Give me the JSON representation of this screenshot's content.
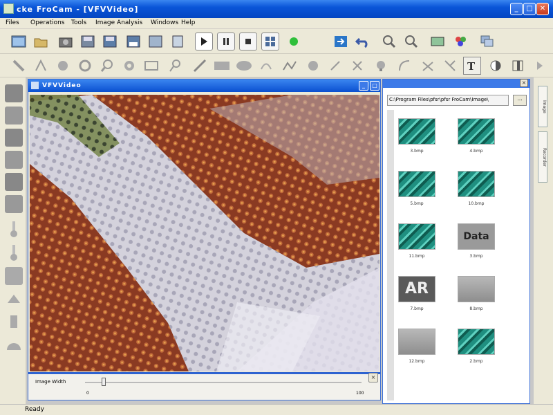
{
  "window": {
    "title": "cke FroCam - [VFVVideo]"
  },
  "menu": [
    "Files",
    "Operations",
    "Tools",
    "Image Analysis",
    "Windows",
    "Help"
  ],
  "toolbar1": [
    "window-icon",
    "folder-icon",
    "camera-icon",
    "save-icon",
    "save-all-icon",
    "save-as-icon",
    "save-disk-icon",
    "save-copy-icon",
    "play-icon",
    "pause-icon",
    "stop-icon",
    "grid-icon",
    "record-icon",
    "export-icon",
    "undo-icon",
    "zoom-in-icon",
    "zoom-out-icon",
    "fit-icon",
    "palette-icon",
    "layers-icon"
  ],
  "toolbar2": [
    "ruler-icon",
    "angle-icon",
    "circle-icon",
    "ring-icon",
    "magnifier-icon",
    "gear-icon",
    "rect-measure-icon",
    "probe-icon",
    "line-icon",
    "rectangle-icon",
    "ellipse-icon",
    "arc-icon",
    "polyline-icon",
    "dot-icon",
    "slash-icon",
    "cross-icon",
    "bulb-icon",
    "curve-icon",
    "triangle-icon",
    "text-icon",
    "contrast-icon",
    "columns-icon",
    "menu-arrow-icon"
  ],
  "lefttools": [
    "brightness-icon",
    "contrast-tool-icon",
    "layer-up-icon",
    "layer-down-icon",
    "sharpen-icon",
    "invert-icon",
    "thermo-icon",
    "thermo-alt-icon",
    "square-tool-icon",
    "lamp-icon",
    "brush-icon",
    "dome-icon"
  ],
  "child_window": {
    "title": "VFVVideo"
  },
  "image_width": {
    "label": "Image Width",
    "min": "0",
    "max": "100",
    "value_fraction": 0.06
  },
  "thumbnail_panel": {
    "path": "C:\\Program Files\\pfsr\\pfsr FroCam\\Image\\",
    "browse_label": "...",
    "items": [
      {
        "name": "3.bmp",
        "kind": "pcb"
      },
      {
        "name": "4.bmp",
        "kind": "pcb"
      },
      {
        "name": "5.bmp",
        "kind": "pcb"
      },
      {
        "name": "10.bmp",
        "kind": "pcb"
      },
      {
        "name": "11.bmp",
        "kind": "pcb"
      },
      {
        "name": "3.bmp",
        "kind": "data"
      },
      {
        "name": "7.bmp",
        "kind": "ar"
      },
      {
        "name": "8.bmp",
        "kind": "gray"
      },
      {
        "name": "12.bmp",
        "kind": "gray"
      },
      {
        "name": "2.bmp",
        "kind": "pcb"
      }
    ],
    "thumb_data_text": "Data",
    "thumb_ar_text": "AR"
  },
  "side_tabs": [
    "Image",
    "Recorder"
  ],
  "status": "Ready",
  "colors": {
    "titlebar": "#0a55d8",
    "accent": "#3d7ae8"
  }
}
